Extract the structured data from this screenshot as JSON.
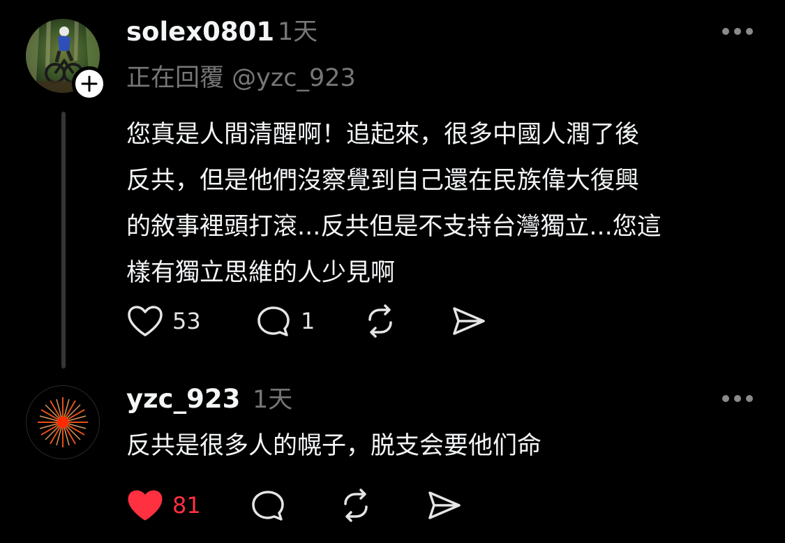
{
  "colors": {
    "background": "#000000",
    "text": "#f3f5f7",
    "muted": "#777777",
    "like_active": "#ff3040"
  },
  "comments": [
    {
      "username": "solex0801",
      "time": "1天",
      "replying_to": "正在回覆 @yzc_923",
      "body_lines": [
        "您真是人間清醒啊！追起來，很多中國人潤了後",
        "反共，但是他們沒察覺到自己還在民族偉大復興",
        "的敘事裡頭打滾...反共但是不支持台灣獨立...您這",
        "樣有獨立思維的人少見啊"
      ],
      "likes": "53",
      "replies": "1",
      "liked": false,
      "icons": [
        "heart-outline-icon",
        "comment-icon",
        "repost-icon",
        "share-icon",
        "more-icon",
        "follow-plus-icon"
      ]
    },
    {
      "username": "yzc_923",
      "time": "1天",
      "body": "反共是很多人的幌子，脱支会要他们命",
      "likes": "81",
      "liked": true,
      "icons": [
        "heart-filled-icon",
        "comment-icon",
        "repost-icon",
        "share-icon",
        "more-icon"
      ]
    }
  ]
}
